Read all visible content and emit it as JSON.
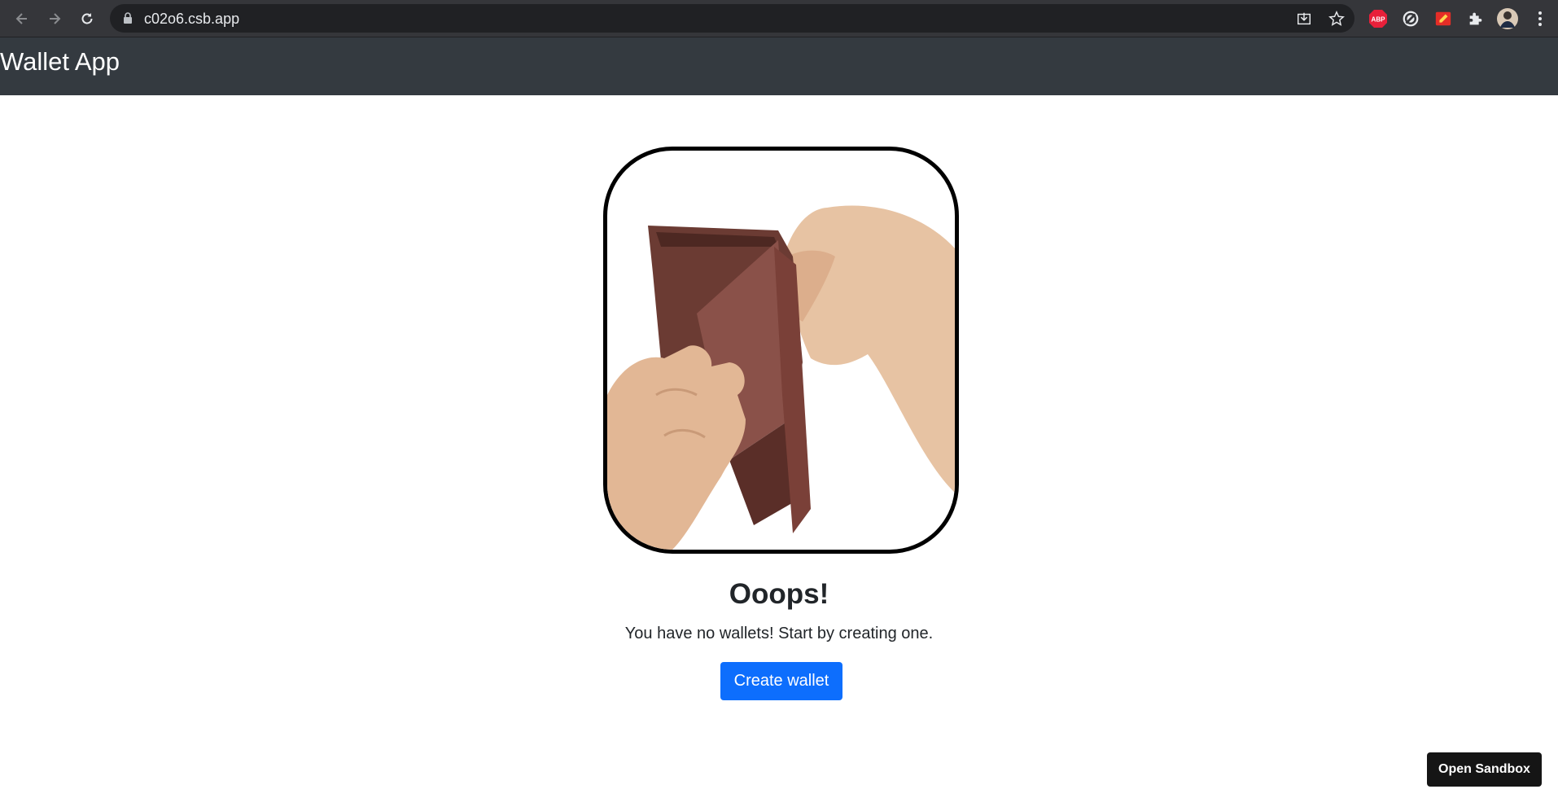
{
  "browser": {
    "url": "c02o6.csb.app",
    "extensions": [
      "abp-icon",
      "block-icon",
      "pdf-extension-icon",
      "puzzle-icon",
      "profile-avatar"
    ],
    "abp_label": "ABP"
  },
  "navbar": {
    "brand": "Wallet App"
  },
  "empty_state": {
    "image": "empty-wallet-hands",
    "heading": "Ooops!",
    "message": "You have no wallets! Start by creating one.",
    "button_label": "Create wallet"
  },
  "sandbox": {
    "button_label": "Open Sandbox"
  },
  "colors": {
    "navbar_bg": "#343a40",
    "primary": "#0d6efd",
    "sandbox_bg": "#151515"
  }
}
